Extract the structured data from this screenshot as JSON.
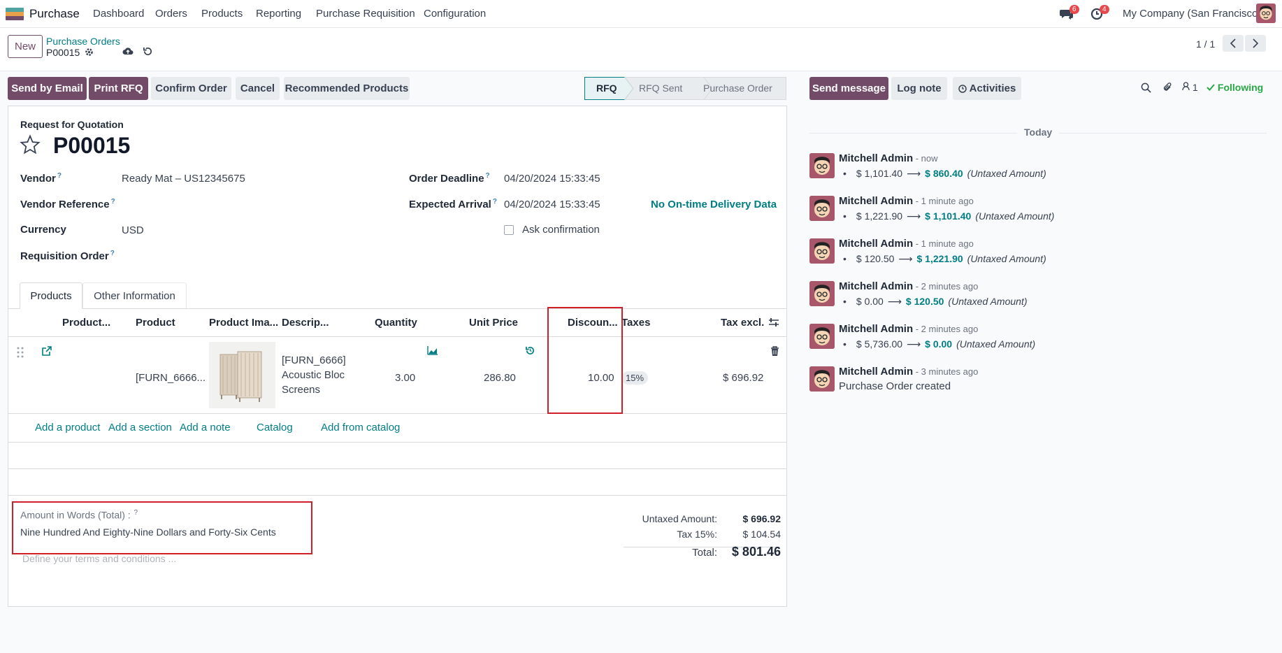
{
  "navbar": {
    "app_name": "Purchase",
    "menu": [
      "Dashboard",
      "Orders",
      "Products",
      "Reporting",
      "Purchase Requisition",
      "Configuration"
    ],
    "messages_count": "6",
    "activities_count": "4",
    "company": "My Company (San Francisco)"
  },
  "control": {
    "new_label": "New",
    "breadcrumb_parent": "Purchase Orders",
    "record_name": "P00015",
    "pager": "1 / 1"
  },
  "actions": {
    "send_by_email": "Send by Email",
    "print_rfq": "Print RFQ",
    "confirm_order": "Confirm Order",
    "cancel": "Cancel",
    "recommended_products": "Recommended Products"
  },
  "statusbar": [
    "RFQ",
    "RFQ Sent",
    "Purchase Order"
  ],
  "form": {
    "subtitle": "Request for Quotation",
    "title": "P00015",
    "vendor_label": "Vendor",
    "vendor_value": "Ready Mat – US12345675",
    "vendor_ref_label": "Vendor Reference",
    "currency_label": "Currency",
    "currency_value": "USD",
    "requisition_label": "Requisition Order",
    "deadline_label": "Order Deadline",
    "deadline_value": "04/20/2024 15:33:45",
    "arrival_label": "Expected Arrival",
    "arrival_value": "04/20/2024 15:33:45",
    "ontime_link": "No On-time Delivery Data",
    "ask_confirmation": "Ask confirmation",
    "tabs": [
      "Products",
      "Other Information"
    ]
  },
  "table": {
    "headers": {
      "product_variant": "Product...",
      "product": "Product",
      "image": "Product Ima...",
      "description": "Descrip...",
      "quantity": "Quantity",
      "unit_price": "Unit Price",
      "discount": "Discoun...",
      "taxes": "Taxes",
      "tax_excl": "Tax excl."
    },
    "row": {
      "product": "[FURN_6666...",
      "desc_line1": "[FURN_6666]",
      "desc_line2": "Acoustic Bloc",
      "desc_line3": "Screens",
      "quantity": "3.00",
      "unit_price": "286.80",
      "discount": "10.00",
      "tax": "15%",
      "subtotal": "$ 696.92"
    },
    "add_links": [
      "Add a product",
      "Add a section",
      "Add a note",
      "Catalog",
      "Add from catalog"
    ]
  },
  "amount_words": {
    "label": "Amount in Words (Total) :",
    "value": "Nine Hundred And Eighty-Nine Dollars and Forty-Six Cents"
  },
  "terms_placeholder": "Define your terms and conditions ...",
  "totals": {
    "untaxed_label": "Untaxed Amount:",
    "untaxed_value": "$ 696.92",
    "tax_label": "Tax 15%:",
    "tax_value": "$ 104.54",
    "total_label": "Total:",
    "total_value": "$ 801.46"
  },
  "chatter": {
    "send_message": "Send message",
    "log_note": "Log note",
    "activities": "Activities",
    "followers": "1",
    "following": "Following",
    "today": "Today",
    "messages": [
      {
        "author": "Mitchell Admin",
        "time": "- now",
        "old": "$ 1,101.40",
        "new": "$ 860.40",
        "field": "(Untaxed Amount)"
      },
      {
        "author": "Mitchell Admin",
        "time": "- 1 minute ago",
        "old": "$ 1,221.90",
        "new": "$ 1,101.40",
        "field": "(Untaxed Amount)"
      },
      {
        "author": "Mitchell Admin",
        "time": "- 1 minute ago",
        "old": "$ 120.50",
        "new": "$ 1,221.90",
        "field": "(Untaxed Amount)"
      },
      {
        "author": "Mitchell Admin",
        "time": "- 2 minutes ago",
        "old": "$ 0.00",
        "new": "$ 120.50",
        "field": "(Untaxed Amount)"
      },
      {
        "author": "Mitchell Admin",
        "time": "- 2 minutes ago",
        "old": "$ 5,736.00",
        "new": "$ 0.00",
        "field": "(Untaxed Amount)"
      }
    ],
    "created": {
      "author": "Mitchell Admin",
      "time": "- 3 minutes ago",
      "text": "Purchase Order created"
    }
  },
  "colors": {
    "brand": "#714b67",
    "link": "#017e84",
    "following": "#28a745",
    "highlight": "#d0202a"
  }
}
